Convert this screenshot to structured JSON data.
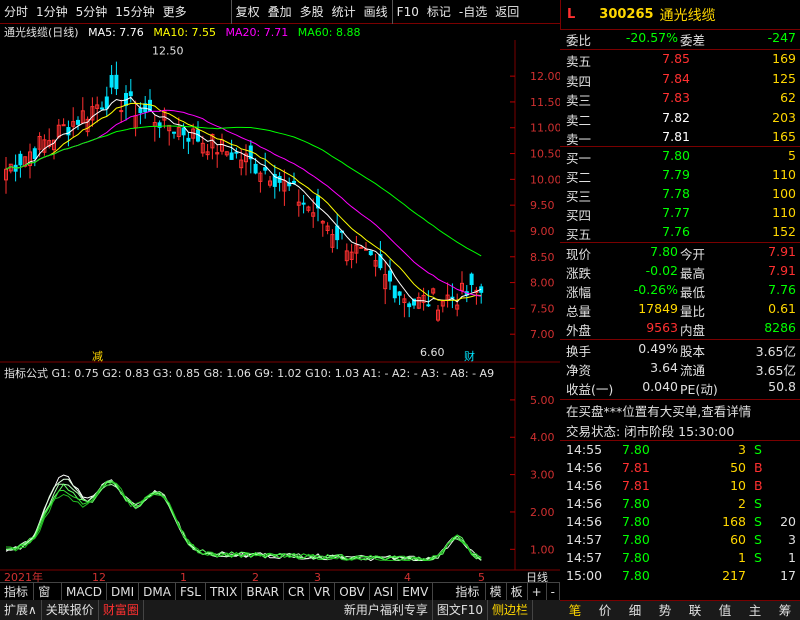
{
  "toolbar": {
    "items": [
      "分时",
      "1分钟",
      "5分钟",
      "15分钟",
      "更多",
      "复权",
      "叠加",
      "多股",
      "统计",
      "画线",
      "F10",
      "标记",
      "-自选",
      "返回"
    ]
  },
  "header": {
    "logo": "L",
    "code": "300265",
    "name": "通光线缆"
  },
  "kline": {
    "title": "通光线缆(日线)",
    "ma5": "MA5: 7.76",
    "ma10": "MA10: 7.55",
    "ma20": "MA20: 7.71",
    "ma60": "MA60: 8.88",
    "y_ticks": [
      "12.00",
      "11.50",
      "11.00",
      "10.50",
      "10.00",
      "9.50",
      "9.00",
      "8.50",
      "8.00",
      "7.50",
      "7.00"
    ],
    "high_label": "12.50",
    "low_label": "6.60",
    "mark1": "减",
    "mark2": "财"
  },
  "indicator": {
    "name": "指标公式",
    "vals": [
      "G1: 0.75",
      "G2: 0.83",
      "G3: 0.85",
      "G8: 1.06",
      "G9: 1.02",
      "G10: 1.03",
      "A1: -",
      "A2: -",
      "A3: -",
      "A8: -",
      "A9"
    ],
    "y_ticks": [
      "5.00",
      "4.00",
      "3.00",
      "2.00",
      "1.00"
    ]
  },
  "xaxis": {
    "labels": [
      "2021年",
      "12",
      "1",
      "2",
      "3",
      "4",
      "5"
    ],
    "period": "日线"
  },
  "bottom_tabs": [
    "指标A",
    "窗口",
    "MACD",
    "DMI",
    "DMA",
    "FSL",
    "TRIX",
    "BRAR",
    "CR",
    "VR",
    "OBV",
    "ASI",
    "EMV",
    "指标B",
    "模",
    "板",
    "+",
    "-"
  ],
  "bottom_bar": [
    "扩展∧",
    "关联报价",
    "财富圈",
    "新用户福利专享",
    "图文F10",
    "侧边栏"
  ],
  "quote": {
    "weibi_label": "委比",
    "weibi": "-20.57%",
    "weicha_label": "委差",
    "weicha": "-247",
    "asks": [
      {
        "l": "卖五",
        "p": "7.85",
        "v": "169"
      },
      {
        "l": "卖四",
        "p": "7.84",
        "v": "125"
      },
      {
        "l": "卖三",
        "p": "7.83",
        "v": "62"
      },
      {
        "l": "卖二",
        "p": "7.82",
        "v": "203"
      },
      {
        "l": "卖一",
        "p": "7.81",
        "v": "165"
      }
    ],
    "bids": [
      {
        "l": "买一",
        "p": "7.80",
        "v": "5"
      },
      {
        "l": "买二",
        "p": "7.79",
        "v": "110"
      },
      {
        "l": "买三",
        "p": "7.78",
        "v": "100"
      },
      {
        "l": "买四",
        "p": "7.77",
        "v": "110"
      },
      {
        "l": "买五",
        "p": "7.76",
        "v": "152"
      }
    ],
    "stats": [
      {
        "l1": "现价",
        "v1": "7.80",
        "l2": "今开",
        "v2": "7.91"
      },
      {
        "l1": "涨跌",
        "v1": "-0.02",
        "l2": "最高",
        "v2": "7.91"
      },
      {
        "l1": "涨幅",
        "v1": "-0.26%",
        "l2": "最低",
        "v2": "7.76"
      },
      {
        "l1": "总量",
        "v1": "17849",
        "l2": "量比",
        "v2": "0.61"
      },
      {
        "l1": "外盘",
        "v1": "9563",
        "l2": "内盘",
        "v2": "8286"
      }
    ],
    "stats2": [
      {
        "l1": "换手",
        "v1": "0.49%",
        "l2": "股本",
        "v2": "3.65亿"
      },
      {
        "l1": "净资",
        "v1": "3.64",
        "l2": "流通",
        "v2": "3.65亿"
      },
      {
        "l1": "收益(一)",
        "v1": "0.040",
        "l2": "PE(动)",
        "v2": "50.8"
      }
    ],
    "notice": "在买盘***位置有大买单,查看详情",
    "status": "交易状态: 闭市阶段 15:30:00"
  },
  "ticks": [
    {
      "t": "14:55",
      "p": "7.80",
      "v": "3",
      "d": "S"
    },
    {
      "t": "14:56",
      "p": "7.81",
      "v": "50",
      "d": "B"
    },
    {
      "t": "14:56",
      "p": "7.81",
      "v": "10",
      "d": "B"
    },
    {
      "t": "14:56",
      "p": "7.80",
      "v": "2",
      "d": "S"
    },
    {
      "t": "14:56",
      "p": "7.80",
      "v": "168",
      "d": "S",
      "n": "20"
    },
    {
      "t": "14:57",
      "p": "7.80",
      "v": "60",
      "d": "S",
      "n": "3"
    },
    {
      "t": "14:57",
      "p": "7.80",
      "v": "1",
      "d": "S",
      "n": "1"
    },
    {
      "t": "15:00",
      "p": "7.80",
      "v": "217",
      "d": "",
      "n": "17"
    }
  ],
  "right_tabs": [
    "笔",
    "价",
    "细",
    "势",
    "联",
    "值",
    "主",
    "筹"
  ],
  "chart_data": {
    "type": "line",
    "title": "通光线缆(日线)",
    "ylim": [
      6.5,
      12.7
    ],
    "series": [
      {
        "name": "MA5",
        "last": 7.76
      },
      {
        "name": "MA10",
        "last": 7.55
      },
      {
        "name": "MA20",
        "last": 7.71
      },
      {
        "name": "MA60",
        "last": 8.88
      }
    ]
  },
  "colors": {
    "up": "#ff3030",
    "down": "#00e5ff",
    "ma5": "#ffffff",
    "ma10": "#ffff00",
    "ma20": "#ff00ff",
    "ma60": "#00ff00",
    "grid": "#7a0000"
  }
}
